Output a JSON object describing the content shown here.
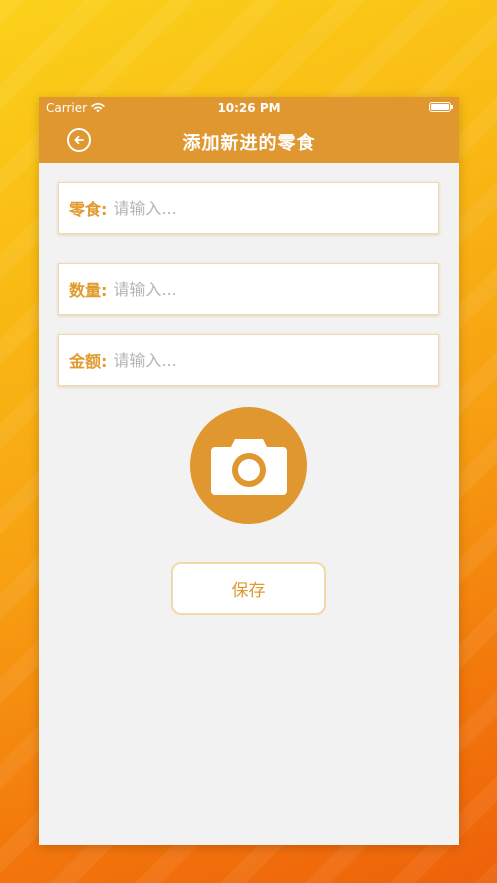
{
  "status_bar": {
    "carrier": "Carrier",
    "time": "10:26 PM"
  },
  "nav": {
    "title": "添加新进的零食",
    "back_icon": "back-arrow-circle-icon"
  },
  "form": {
    "fields": [
      {
        "label": "零食:",
        "placeholder": "请输入...",
        "value": ""
      },
      {
        "label": "数量:",
        "placeholder": "请输入...",
        "value": ""
      },
      {
        "label": "金额:",
        "placeholder": "请输入...",
        "value": ""
      }
    ],
    "camera_icon": "camera-icon",
    "save_label": "保存"
  },
  "colors": {
    "accent": "#e0972f",
    "screen_bg": "#f2f2f2",
    "placeholder": "#b4b4b4"
  }
}
